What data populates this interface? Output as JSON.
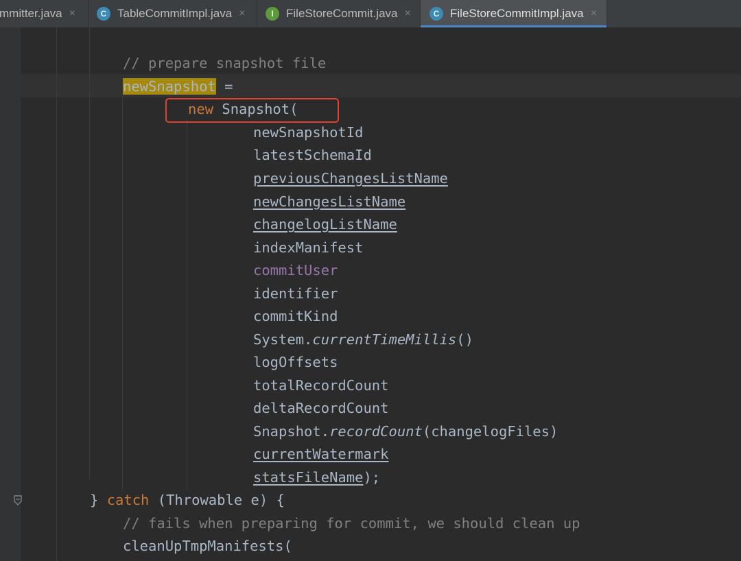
{
  "tabs": [
    {
      "label": "mmitter.java",
      "icon": null,
      "active": false
    },
    {
      "label": "TableCommitImpl.java",
      "icon": "class-icon",
      "icon_letter": "C",
      "active": false
    },
    {
      "label": "FileStoreCommit.java",
      "icon": "interface-icon",
      "icon_letter": "I",
      "active": false
    },
    {
      "label": "FileStoreCommitImpl.java",
      "icon": "class-icon",
      "icon_letter": "C",
      "active": true
    }
  ],
  "close_glyph": "×",
  "code": {
    "comment_prepare": "// prepare snapshot file",
    "var_new_snapshot": "newSnapshot",
    "assign_op": " =",
    "kw_new": "new",
    "ctor_call": " Snapshot(",
    "args": {
      "a1": "newSnapshotId",
      "a2": "latestSchemaId",
      "a3": "previousChangesListName",
      "a4": "newChangesListName",
      "a5": "changelogListName",
      "a6": "indexManifest",
      "a7": "commitUser",
      "a8": "identifier",
      "a9": "commitKind",
      "a10_obj": "System.",
      "a10_method": "currentTimeMillis",
      "a10_parens": "()",
      "a11": "logOffsets",
      "a12": "totalRecordCount",
      "a13": "deltaRecordCount",
      "a14_obj": "Snapshot.",
      "a14_method": "recordCount",
      "a14_args": "(changelogFiles)",
      "a15": "currentWatermark",
      "a16": "statsFileName"
    },
    "comma": ",",
    "close_stmt": ");",
    "brace_close": "}",
    "kw_catch": "catch",
    "catch_params": " (Throwable e) {",
    "comment_fail": "// fails when preparing for commit, we should clean up",
    "cleanup_call": "cleanUpTmpManifests("
  },
  "colors": {
    "keyword": "#cc7832",
    "comment": "#808080",
    "field": "#9876aa",
    "highlight": "#a68a0d",
    "annotation_box": "#e5402c",
    "active_tab_underline": "#4a88c7"
  }
}
